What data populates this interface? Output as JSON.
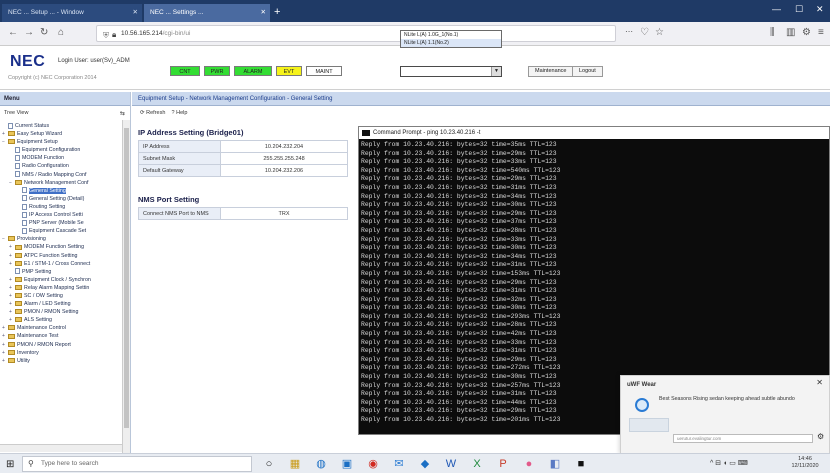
{
  "browser": {
    "tabs": [
      {
        "label": "NEC ... Setup ... - Window"
      },
      {
        "label": "NEC ... Settings ..."
      }
    ],
    "url_host": "10.56.165.214",
    "url_path": "/cgi-bin/ui"
  },
  "header": {
    "logo": "NEC",
    "login_info": "Login User: user(Sv)_ADM",
    "copyright": "Copyright (c) NEC Corporation 2014",
    "status_buttons": [
      {
        "label": "CNT",
        "color": "#33dd33"
      },
      {
        "label": "PWR",
        "color": "#33dd33"
      },
      {
        "label": "ALARM",
        "color": "#33dd33"
      },
      {
        "label": "EVT",
        "color": "#f6f31a"
      },
      {
        "label": "MAINT",
        "color": "#ffffff"
      }
    ],
    "selector_options": [
      "NLite L(A) 1.0G_1(No.1)",
      "NLite L(A) 1.1(No.2)"
    ],
    "maintenance_button": "Maintenance",
    "logout_button": "Logout"
  },
  "leftpanel": {
    "title": "Menu",
    "tool_label": "Tree View",
    "tree": [
      {
        "label": "Current Status",
        "level": 0,
        "type": "doc"
      },
      {
        "label": "Easy Setup Wizard",
        "level": 0,
        "type": "folder",
        "exp": "+"
      },
      {
        "label": "Equipment Setup",
        "level": 0,
        "type": "folder",
        "exp": "-"
      },
      {
        "label": "Equipment Configuration",
        "level": 1,
        "type": "doc"
      },
      {
        "label": "MODEM Function",
        "level": 1,
        "type": "doc"
      },
      {
        "label": "Radio Configuration",
        "level": 1,
        "type": "doc"
      },
      {
        "label": "NMS / Radio Mapping Conf",
        "level": 1,
        "type": "doc"
      },
      {
        "label": "Network Management Conf",
        "level": 1,
        "type": "folder",
        "exp": "-"
      },
      {
        "label": "General Setting",
        "level": 2,
        "type": "doc",
        "selected": true
      },
      {
        "label": "General Setting (Detail)",
        "level": 2,
        "type": "doc"
      },
      {
        "label": "Routing Setting",
        "level": 2,
        "type": "doc"
      },
      {
        "label": "IP Access Control Setti",
        "level": 2,
        "type": "doc"
      },
      {
        "label": "PNP Server (Mobile Se",
        "level": 2,
        "type": "doc"
      },
      {
        "label": "Equipment Cascade Set",
        "level": 2,
        "type": "doc"
      },
      {
        "label": "Provisioning",
        "level": 0,
        "type": "folder",
        "exp": "-"
      },
      {
        "label": "MODEM Function Setting",
        "level": 1,
        "type": "folder",
        "exp": "+"
      },
      {
        "label": "ATPC Function Setting",
        "level": 1,
        "type": "folder",
        "exp": "+"
      },
      {
        "label": "E1 / STM-1 / Cross Connect",
        "level": 1,
        "type": "folder",
        "exp": "+"
      },
      {
        "label": "PMP Setting",
        "level": 1,
        "type": "doc"
      },
      {
        "label": "Equipment Clock / Synchron",
        "level": 1,
        "type": "folder",
        "exp": "+"
      },
      {
        "label": "Relay Alarm Mapping Settin",
        "level": 1,
        "type": "folder",
        "exp": "+"
      },
      {
        "label": "SC / OW Setting",
        "level": 1,
        "type": "folder",
        "exp": "+"
      },
      {
        "label": "Alarm / LED Setting",
        "level": 1,
        "type": "folder",
        "exp": "+"
      },
      {
        "label": "PMON / RMON Setting",
        "level": 1,
        "type": "folder",
        "exp": "+"
      },
      {
        "label": "ALS Setting",
        "level": 1,
        "type": "folder",
        "exp": "+"
      },
      {
        "label": "Maintenance Control",
        "level": 0,
        "type": "folder",
        "exp": "+"
      },
      {
        "label": "Maintenance Test",
        "level": 0,
        "type": "folder",
        "exp": "+"
      },
      {
        "label": "PMON / RMON Report",
        "level": 0,
        "type": "folder",
        "exp": "+"
      },
      {
        "label": "Inventory",
        "level": 0,
        "type": "folder",
        "exp": "+"
      },
      {
        "label": "Utility",
        "level": 0,
        "type": "folder",
        "exp": "+"
      }
    ]
  },
  "content": {
    "breadcrumb": "Equipment Setup - Network Management Configuration - General Setting",
    "tool_refresh": "Refresh",
    "tool_help": "Help",
    "ip_section_title": "IP Address Setting (Bridge01)",
    "ip_rows": [
      {
        "key": "IP Address",
        "value": "10.204.232.204"
      },
      {
        "key": "Subnet Mask",
        "value": "255.255.255.248"
      },
      {
        "key": "Default Gateway",
        "value": "10.204.232.206"
      }
    ],
    "nms_section_title": "NMS Port Setting",
    "nms_rows": [
      {
        "key": "Connect NMS Port to NMS",
        "value": "TRX"
      }
    ]
  },
  "cmd": {
    "title": "Command Prompt - ping 10.23.40.216 -t",
    "lines": [
      "Reply from 10.23.40.216: bytes=32 time=35ms TTL=123",
      "Reply from 10.23.40.216: bytes=32 time=29ms TTL=123",
      "Reply from 10.23.40.216: bytes=32 time=33ms TTL=123",
      "Reply from 10.23.40.216: bytes=32 time=540ms TTL=123",
      "Reply from 10.23.40.216: bytes=32 time=29ms TTL=123",
      "Reply from 10.23.40.216: bytes=32 time=31ms TTL=123",
      "Reply from 10.23.40.216: bytes=32 time=34ms TTL=123",
      "Reply from 10.23.40.216: bytes=32 time=30ms TTL=123",
      "Reply from 10.23.40.216: bytes=32 time=29ms TTL=123",
      "Reply from 10.23.40.216: bytes=32 time=37ms TTL=123",
      "Reply from 10.23.40.216: bytes=32 time=28ms TTL=123",
      "Reply from 10.23.40.216: bytes=32 time=33ms TTL=123",
      "Reply from 10.23.40.216: bytes=32 time=30ms TTL=123",
      "Reply from 10.23.40.216: bytes=32 time=34ms TTL=123",
      "Reply from 10.23.40.216: bytes=32 time=31ms TTL=123",
      "Reply from 10.23.40.216: bytes=32 time=153ms TTL=123",
      "Reply from 10.23.40.216: bytes=32 time=29ms TTL=123",
      "Reply from 10.23.40.216: bytes=32 time=31ms TTL=123",
      "Reply from 10.23.40.216: bytes=32 time=32ms TTL=123",
      "Reply from 10.23.40.216: bytes=32 time=30ms TTL=123",
      "Reply from 10.23.40.216: bytes=32 time=293ms TTL=123",
      "Reply from 10.23.40.216: bytes=32 time=28ms TTL=123",
      "Reply from 10.23.40.216: bytes=32 time=42ms TTL=123",
      "Reply from 10.23.40.216: bytes=32 time=33ms TTL=123",
      "Reply from 10.23.40.216: bytes=32 time=31ms TTL=123",
      "Reply from 10.23.40.216: bytes=32 time=29ms TTL=123",
      "Reply from 10.23.40.216: bytes=32 time=272ms TTL=123",
      "Reply from 10.23.40.216: bytes=32 time=30ms TTL=123",
      "Reply from 10.23.40.216: bytes=32 time=257ms TTL=123",
      "Reply from 10.23.40.216: bytes=32 time=31ms TTL=123",
      "Reply from 10.23.40.216: bytes=32 time=44ms TTL=123",
      "Reply from 10.23.40.216: bytes=32 time=29ms TTL=123",
      "Reply from 10.23.40.216: bytes=32 time=201ms TTL=123"
    ]
  },
  "notification": {
    "title": "uWF Wear",
    "text": "Best Seasons Rising sedan keeping ahead subtle abundo",
    "reply_placeholder": "uerutur.evalingtur.com"
  },
  "taskbar": {
    "search_placeholder": "Type here to search",
    "time": "14:46",
    "date": "12/11/2020"
  },
  "colors": {
    "header_blue": "#1a2f8a",
    "panel_title": "#cbd9ee",
    "selected_tree": "#3f6fc6"
  }
}
